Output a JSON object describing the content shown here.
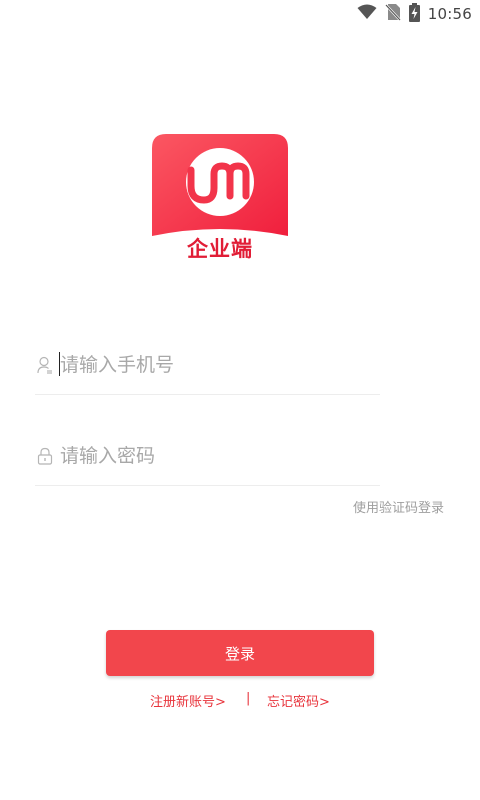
{
  "status_bar": {
    "time": "10:56",
    "icons": [
      "wifi-icon",
      "no-sim-icon",
      "battery-charging-icon"
    ]
  },
  "logo": {
    "caption": "企业端",
    "colors": {
      "primary": "#f32f45",
      "text": "#e11d36"
    }
  },
  "form": {
    "phone_placeholder": "请输入手机号",
    "password_placeholder": "请输入密码",
    "sms_login_label": "使用验证码登录",
    "login_button": "登录"
  },
  "footer": {
    "register_label": "注册新账号>",
    "divider": "|",
    "forgot_label": "忘记密码>"
  },
  "theme": {
    "accent": "#f2464c",
    "link": "#e8343c",
    "placeholder": "#a8a8a8"
  }
}
